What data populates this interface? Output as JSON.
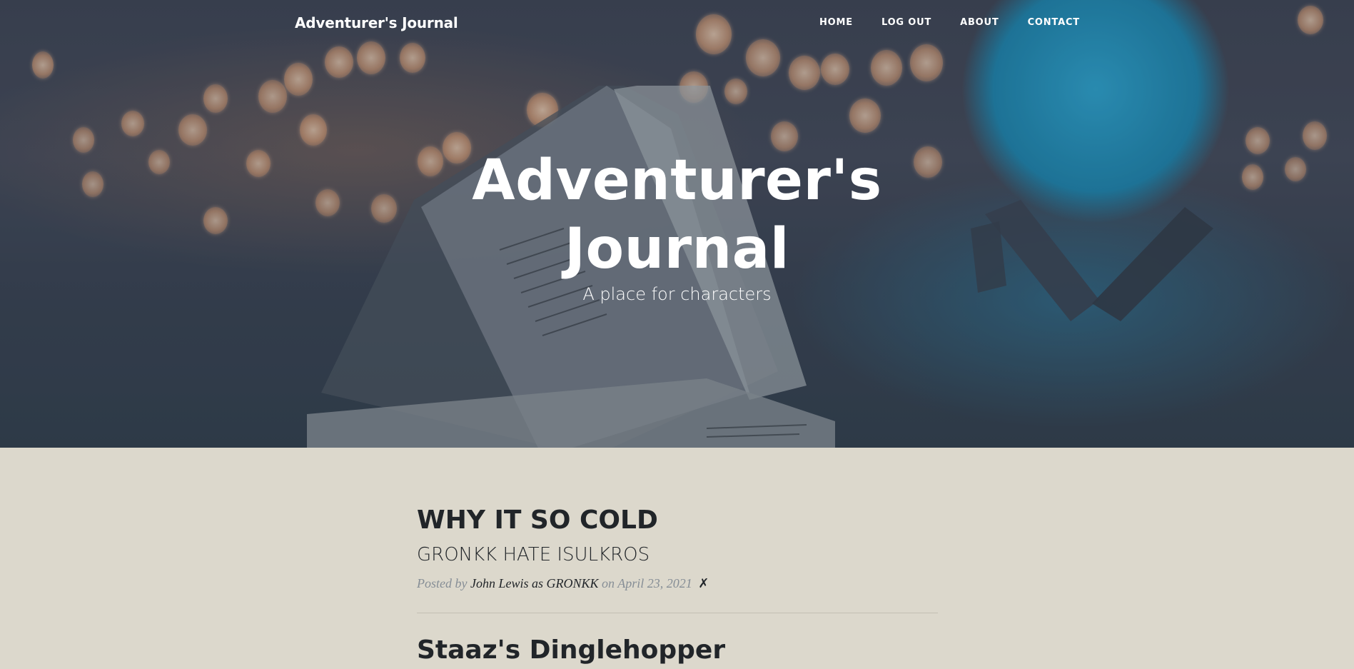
{
  "nav": {
    "brand": "Adventurer's Journal",
    "links": [
      "HOME",
      "LOG OUT",
      "ABOUT",
      "CONTACT"
    ]
  },
  "hero": {
    "title_line1": "Adventurer's",
    "title_line2": "Journal",
    "subtitle": "A place for characters"
  },
  "posts": [
    {
      "title": "WHY IT SO COLD",
      "subtitle": "GRONKK HATE ISULKROS",
      "meta_prefix": "Posted by",
      "author": "John Lewis as GRONKK",
      "date_prefix": "on",
      "date": "April 23, 2021",
      "delete_symbol": "✗"
    },
    {
      "title": "Staaz's Dinglehopper"
    }
  ],
  "colors": {
    "page_background": "#dcd8cc",
    "text_dark": "#212529",
    "text_muted": "#868e96",
    "globe_blue": "#2ea3cf"
  }
}
